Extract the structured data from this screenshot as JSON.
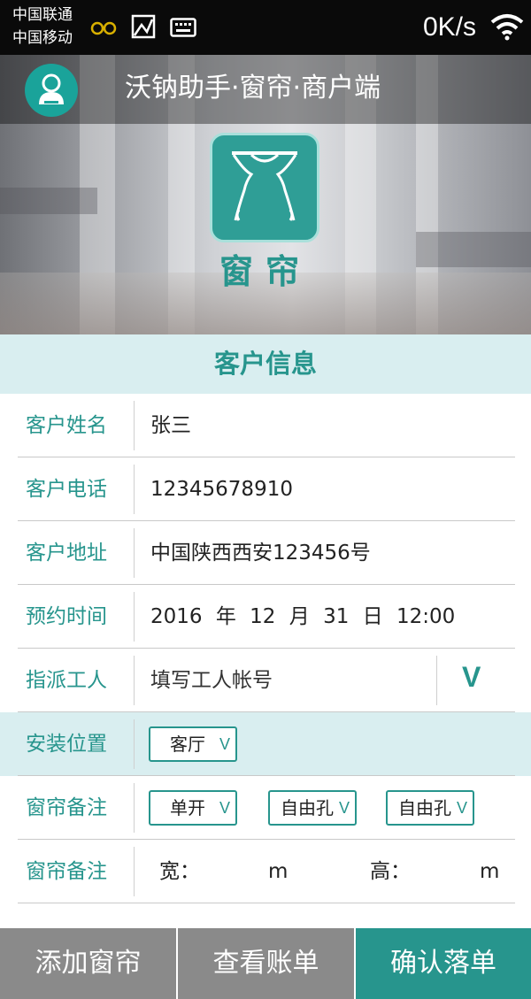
{
  "status_bar": {
    "carrier_1": "中国联通",
    "carrier_2": "中国移动",
    "net_speed": "0K/s",
    "icons": [
      "glasses-icon",
      "image-icon",
      "keyboard-icon",
      "wifi-icon"
    ]
  },
  "app": {
    "title": "沃钠助手·窗帘·商户端",
    "logo_text": "窗帘",
    "accent_color": "#27958d"
  },
  "section_title": "客户信息",
  "form": {
    "name": {
      "label": "客户姓名",
      "value": "张三"
    },
    "phone": {
      "label": "客户电话",
      "value": "12345678910"
    },
    "address": {
      "label": "客户地址",
      "value": "中国陕西西安123456号"
    },
    "appointment": {
      "label": "预约时间",
      "year": "2016",
      "year_unit": "年",
      "month": "12",
      "month_unit": "月",
      "day": "31",
      "day_unit": "日",
      "time": "12:00"
    },
    "worker": {
      "label": "指派工人",
      "placeholder": "填写工人帐号",
      "dropdown": "V"
    },
    "location": {
      "label": "安装位置",
      "selected": "客厅",
      "arrow": "V"
    },
    "curtain_options": {
      "label": "窗帘备注",
      "open_type": "单开",
      "hole_1": "自由孔",
      "hole_2": "自由孔",
      "arrow": "V"
    },
    "curtain_size": {
      "label": "窗帘备注",
      "width_label": "宽：",
      "width_unit": "m",
      "height_label": "高：",
      "height_unit": "m"
    }
  },
  "bottom_bar": {
    "add": "添加窗帘",
    "view": "查看账单",
    "confirm": "确认落单"
  }
}
